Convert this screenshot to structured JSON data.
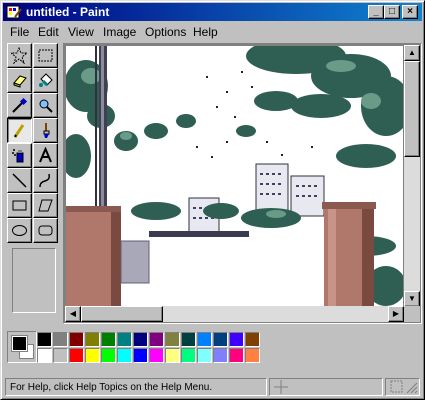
{
  "window": {
    "title": "untitled - Paint",
    "controls": {
      "minimize": "_",
      "maximize": "□",
      "close": "×"
    }
  },
  "menu": [
    "File",
    "Edit",
    "View",
    "Image",
    "Options",
    "Help"
  ],
  "tools": [
    {
      "name": "free-form-select",
      "icon": "star-select-icon"
    },
    {
      "name": "select",
      "icon": "rect-select-icon"
    },
    {
      "name": "eraser",
      "icon": "eraser-icon"
    },
    {
      "name": "fill",
      "icon": "paint-bucket-icon"
    },
    {
      "name": "pick-color",
      "icon": "eyedropper-icon"
    },
    {
      "name": "magnifier",
      "icon": "magnifier-icon"
    },
    {
      "name": "pencil",
      "icon": "pencil-icon",
      "active": true
    },
    {
      "name": "brush",
      "icon": "brush-icon"
    },
    {
      "name": "airbrush",
      "icon": "airbrush-icon"
    },
    {
      "name": "text",
      "icon": "text-icon"
    },
    {
      "name": "line",
      "icon": "line-icon"
    },
    {
      "name": "curve",
      "icon": "curve-icon"
    },
    {
      "name": "rectangle",
      "icon": "rectangle-icon"
    },
    {
      "name": "polygon",
      "icon": "polygon-icon"
    },
    {
      "name": "ellipse",
      "icon": "ellipse-icon"
    },
    {
      "name": "rounded-rectangle",
      "icon": "rounded-rect-icon"
    }
  ],
  "palette": {
    "foreground": "#000000",
    "background": "#ffffff",
    "top_row": [
      "#000000",
      "#808080",
      "#800000",
      "#808000",
      "#008000",
      "#008080",
      "#000080",
      "#800080",
      "#808040",
      "#004040",
      "#0080ff",
      "#004080",
      "#4000ff",
      "#804000"
    ],
    "bottom_row": [
      "#ffffff",
      "#c0c0c0",
      "#ff0000",
      "#ffff00",
      "#00ff00",
      "#00ffff",
      "#0000ff",
      "#ff00ff",
      "#ffff80",
      "#00ff80",
      "#80ffff",
      "#8080ff",
      "#ff0080",
      "#ff8040"
    ]
  },
  "status": {
    "help_text": "For Help, click Help Topics on the Help Menu."
  }
}
